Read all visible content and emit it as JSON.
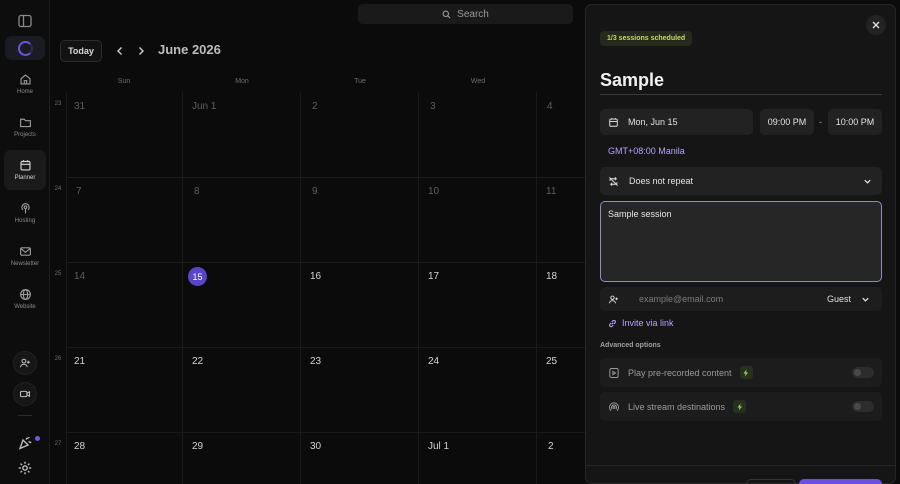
{
  "search": {
    "label": "Search"
  },
  "sidebar": {
    "items": [
      {
        "label": "Home",
        "icon": "home-icon"
      },
      {
        "label": "Projects",
        "icon": "folder-icon"
      },
      {
        "label": "Planner",
        "icon": "calendar-icon",
        "active": true
      },
      {
        "label": "Hosting",
        "icon": "podcast-icon"
      },
      {
        "label": "Newsletter",
        "icon": "mail-icon"
      },
      {
        "label": "Website",
        "icon": "globe-icon"
      }
    ]
  },
  "calendar": {
    "today_label": "Today",
    "month_title": "June 2026",
    "day_headers": [
      "Sun",
      "Mon",
      "Tue",
      "Wed"
    ],
    "week_numbers": [
      "23",
      "24",
      "25",
      "26",
      "27"
    ],
    "weeks": [
      [
        "31",
        "Jun 1",
        "2",
        "3",
        "4"
      ],
      [
        "7",
        "8",
        "9",
        "10",
        "11"
      ],
      [
        "14",
        "15",
        "16",
        "17",
        "18"
      ],
      [
        "21",
        "22",
        "23",
        "24",
        "25"
      ],
      [
        "28",
        "29",
        "30",
        "Jul 1",
        "2"
      ]
    ],
    "today_date": "15"
  },
  "panel": {
    "sessions_badge": "1/3 sessions scheduled",
    "title": "Sample",
    "date": "Mon, Jun 15",
    "start_time": "09:00 PM",
    "time_separator": "-",
    "end_time": "10:00 PM",
    "timezone": "GMT+08:00 Manila",
    "repeat": "Does not repeat",
    "description": "Sample session",
    "guest_placeholder": "example@email.com",
    "guest_role": "Guest",
    "invite_link": "Invite via link",
    "advanced_label": "Advanced options",
    "options": [
      {
        "label": "Play pre-recorded content",
        "enabled": false
      },
      {
        "label": "Live stream destinations",
        "enabled": false
      }
    ]
  },
  "colors": {
    "accent": "#6b4fe0",
    "link": "#b8a3ff",
    "badge_text": "#c4d96a"
  }
}
